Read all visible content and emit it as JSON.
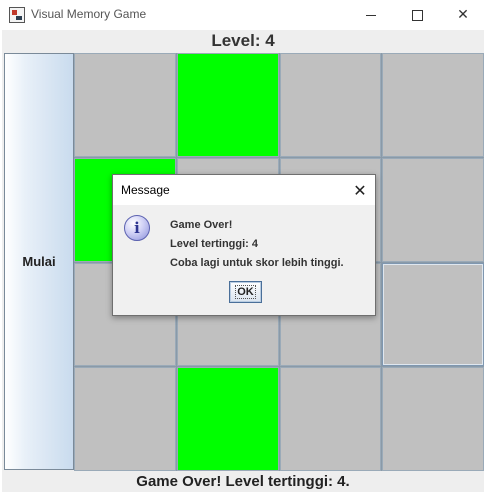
{
  "window": {
    "title": "Visual Memory Game",
    "controls": {
      "minimize": "minimize-icon",
      "maximize": "maximize-icon",
      "close": "✕"
    }
  },
  "header": {
    "level_text": "Level: 4"
  },
  "sidebar": {
    "start_label": "Mulai"
  },
  "grid": {
    "rows": 4,
    "columns": 4,
    "tile_default_color": "#c0c0c0",
    "tile_active_color": "#00ff00",
    "green_tiles": [
      [
        0,
        1
      ],
      [
        1,
        0
      ],
      [
        3,
        1
      ]
    ]
  },
  "footer": {
    "status_text": "Game Over! Level tertinggi: 4."
  },
  "dialog": {
    "title": "Message",
    "close_glyph": "✕",
    "icon": "info-icon",
    "icon_glyph": "i",
    "lines": [
      "Game Over!",
      "Level tertinggi: 4",
      "Coba lagi untuk skor lebih tinggi."
    ],
    "ok_label": "OK"
  }
}
